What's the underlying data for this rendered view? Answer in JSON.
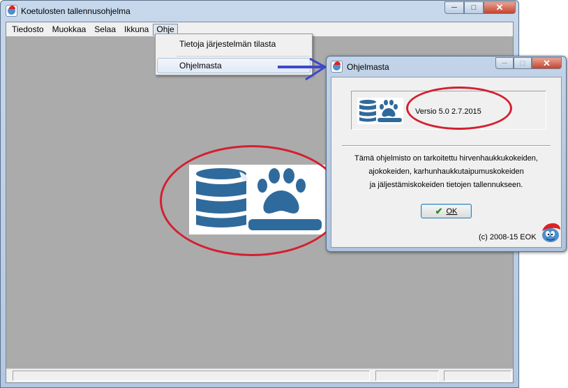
{
  "window": {
    "title": "Koetulosten tallennusohjelma",
    "caption": {
      "minimize": "─",
      "maximize": "□",
      "close": "✕"
    }
  },
  "menubar": {
    "items": [
      "Tiedosto",
      "Muokkaa",
      "Selaa",
      "Ikkuna",
      "Ohje"
    ],
    "open_menu": "Ohje"
  },
  "help_menu": {
    "items": [
      "Tietoja järjestelmän tilasta",
      "Ohjelmasta"
    ],
    "highlighted": "Ohjelmasta"
  },
  "about_dialog": {
    "title": "Ohjelmasta",
    "version": "Versio 5.0   2.7.2015",
    "description": [
      "Tämä ohjelmisto on tarkoitettu hirvenhaukkukokeiden,",
      "ajokokeiden, karhunhaukkutaipumuskokeiden",
      "ja jäljestämiskokeiden tietojen tallennukseen."
    ],
    "ok_label": "OK",
    "copyright": "(c) 2008-15  EOK"
  },
  "icons": {
    "app": "smurf-icon",
    "logo": "database-paw-logo",
    "ok": "checkmark-icon",
    "annotation": "blue-arrow"
  },
  "colors": {
    "logo_blue": "#2f6a9c",
    "annotation_red": "#d32030",
    "annotation_blue": "#3d49c9",
    "client_gray": "#ababab"
  }
}
